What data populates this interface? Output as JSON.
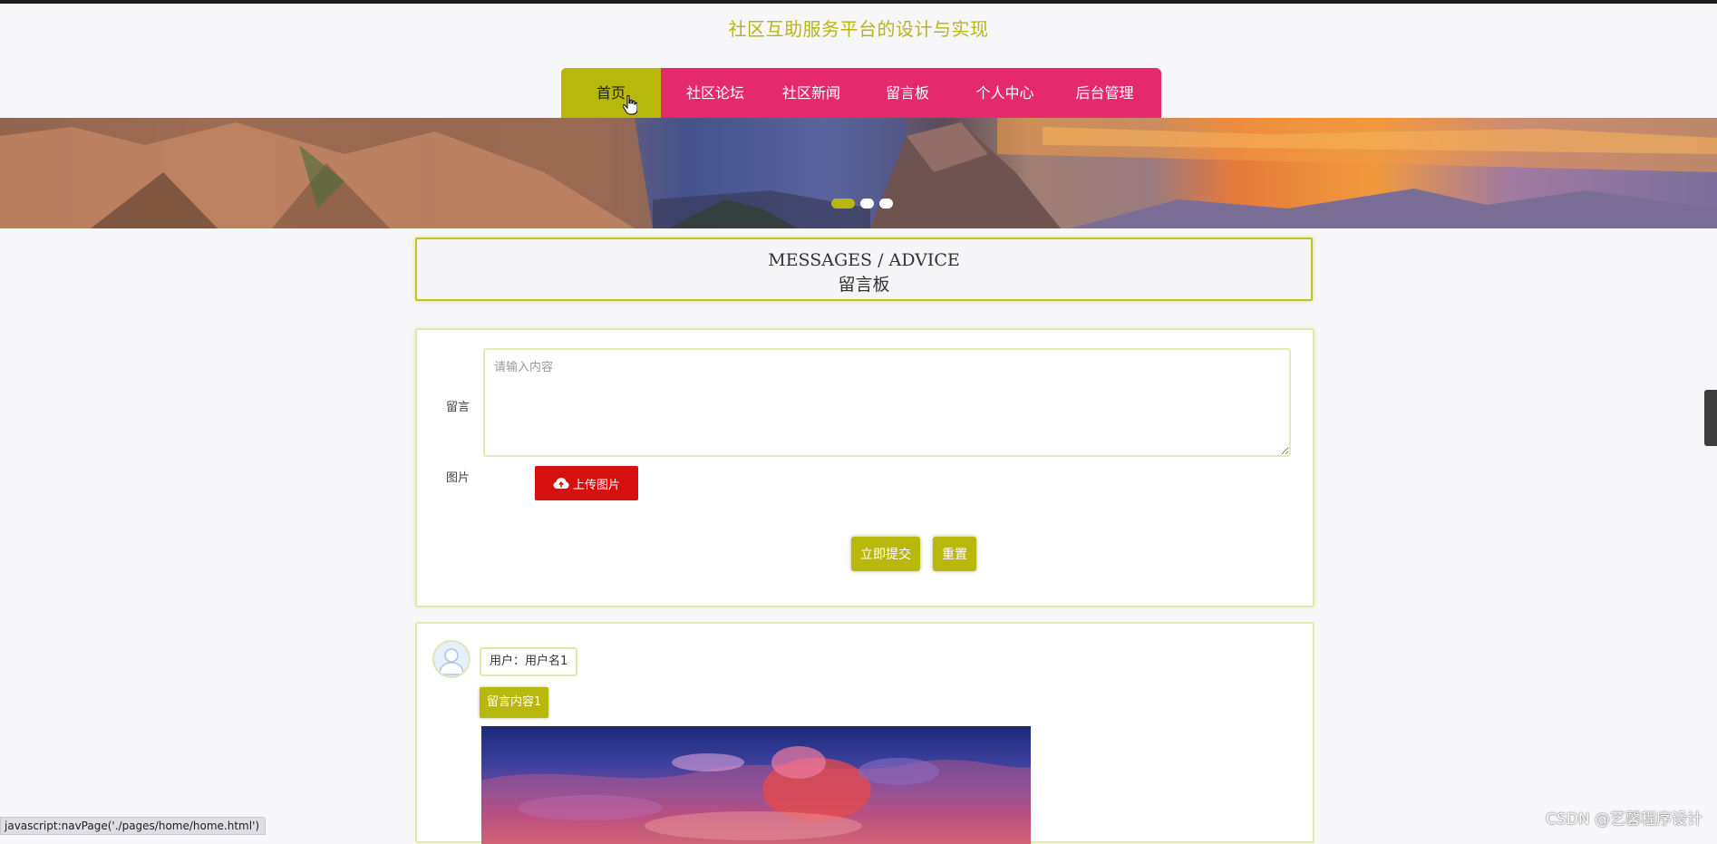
{
  "header": {
    "site_title": "社区互助服务平台的设计与实现"
  },
  "nav": {
    "items": [
      {
        "label": "首页",
        "active": true
      },
      {
        "label": "社区论坛",
        "active": false
      },
      {
        "label": "社区新闻",
        "active": false
      },
      {
        "label": "留言板",
        "active": false
      },
      {
        "label": "个人中心",
        "active": false
      },
      {
        "label": "后台管理",
        "active": false
      }
    ]
  },
  "banner": {
    "slides": 3,
    "active_slide": 1
  },
  "page_heading": {
    "english": "MESSAGES / ADVICE",
    "chinese": "留言板"
  },
  "form": {
    "message_label": "留言",
    "message_placeholder": "请输入内容",
    "message_value": "",
    "image_label": "图片",
    "upload_button": "上传图片",
    "submit_button": "立即提交",
    "reset_button": "重置"
  },
  "messages": [
    {
      "user": "用户：用户名1",
      "content": "留言内容1"
    }
  ],
  "status_bar": {
    "text": "javascript:navPage('./pages/home/home.html')"
  },
  "watermark": {
    "text": "CSDN @艺馨程序设计"
  },
  "colors": {
    "accent": "#b8b70c",
    "nav_background": "#e42a6d",
    "upload_button": "#d60f0f",
    "title_text": "#b7b517"
  },
  "icons": {
    "upload": "cloud-upload-icon",
    "avatar": "user-avatar-icon",
    "cursor": "hand-pointer-icon"
  }
}
